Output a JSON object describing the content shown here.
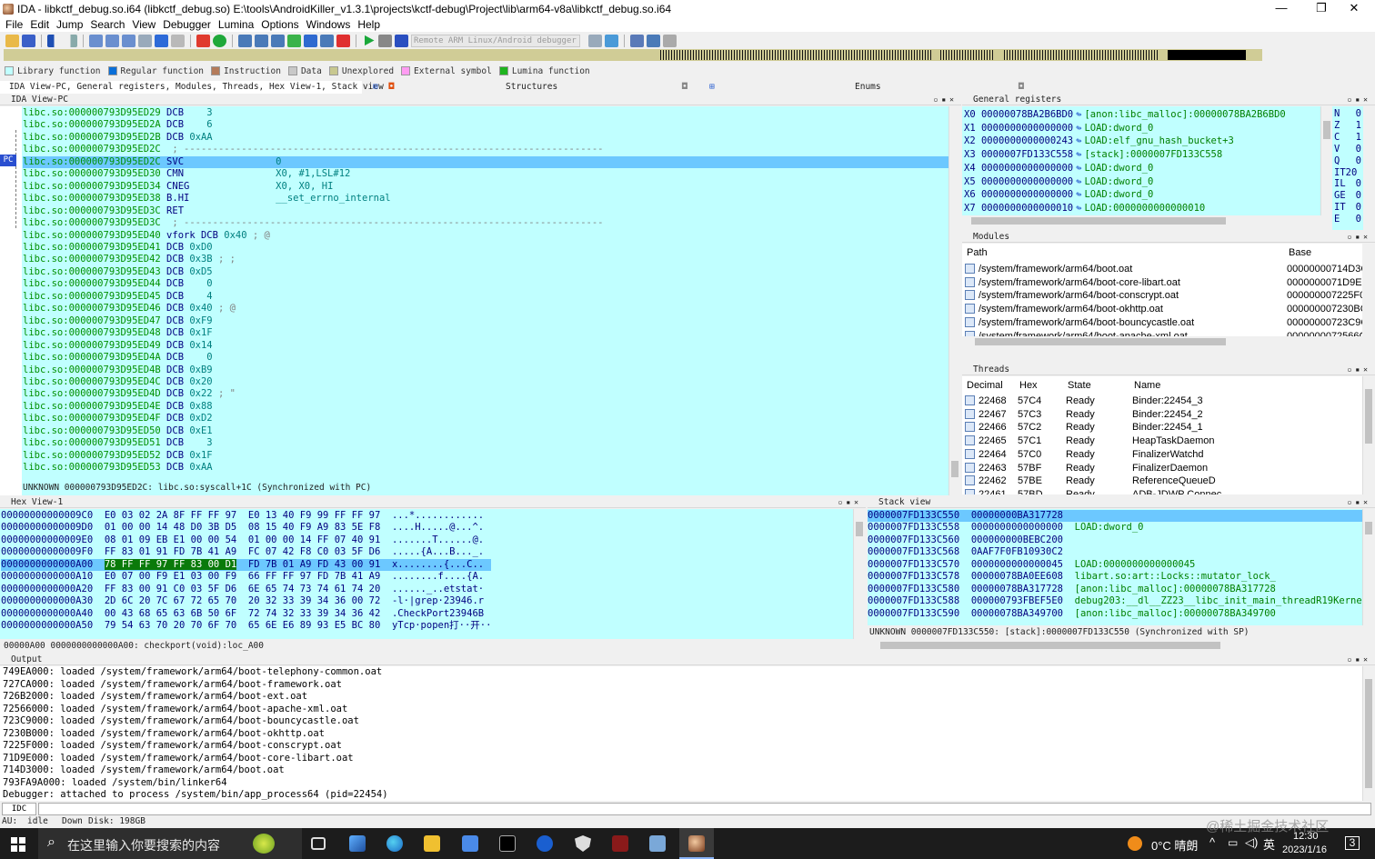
{
  "window": {
    "title": "IDA - libkctf_debug.so.i64 (libkctf_debug.so) E:\\tools\\AndroidKiller_v1.3.1\\projects\\kctf-debug\\Project\\lib\\arm64-v8a\\libkctf_debug.so.i64",
    "minimize": "—",
    "maximize": "❐",
    "close": "✕"
  },
  "menu": [
    "File",
    "Edit",
    "Jump",
    "Search",
    "View",
    "Debugger",
    "Lumina",
    "Options",
    "Windows",
    "Help"
  ],
  "toolbar": {
    "debugger_select": "Remote ARM Linux/Android debugger"
  },
  "legend": [
    {
      "label": "Library function",
      "color": "#c0ffff"
    },
    {
      "label": "Regular function",
      "color": "#0a6fd8"
    },
    {
      "label": "Instruction",
      "color": "#b47b5a"
    },
    {
      "label": "Data",
      "color": "#c8c8c8"
    },
    {
      "label": "Unexplored",
      "color": "#c8c890"
    },
    {
      "label": "External symbol",
      "color": "#ff9cf2"
    },
    {
      "label": "Lumina function",
      "color": "#1fb41f"
    }
  ],
  "tabs": {
    "main": "IDA View-PC, General registers, Modules, Threads, Hex View-1, Stack view",
    "structures": "Structures",
    "enums": "Enums"
  },
  "ida_view": {
    "title": "IDA View-PC",
    "pc_marker": "PC",
    "lines": [
      {
        "addr": "libc.so:000000793D95ED29",
        "mn": "DCB",
        "op": "   3",
        "cm": ""
      },
      {
        "addr": "libc.so:000000793D95ED2A",
        "mn": "DCB",
        "op": "   6",
        "cm": ""
      },
      {
        "addr": "libc.so:000000793D95ED2B",
        "mn": "DCB",
        "op": "0xAA",
        "cm": ""
      },
      {
        "addr": "libc.so:000000793D95ED2C",
        "mn": "",
        "op": "",
        "cm": "; -------------------------------------------------------------------------"
      },
      {
        "addr": "libc.so:000000793D95ED2C",
        "mn": "SVC",
        "op": "               0",
        "cm": "",
        "pc": true
      },
      {
        "addr": "libc.so:000000793D95ED30",
        "mn": "CMN",
        "op": "               X0, #1,LSL#12",
        "cm": ""
      },
      {
        "addr": "libc.so:000000793D95ED34",
        "mn": "CNEG",
        "op": "              X0, X0, HI",
        "cm": ""
      },
      {
        "addr": "libc.so:000000793D95ED38",
        "mn": "B.HI",
        "op": "              __set_errno_internal",
        "cm": ""
      },
      {
        "addr": "libc.so:000000793D95ED3C",
        "mn": "RET",
        "op": "",
        "cm": ""
      },
      {
        "addr": "libc.so:000000793D95ED3C",
        "mn": "",
        "op": "",
        "cm": "; -------------------------------------------------------------------------"
      },
      {
        "addr": "libc.so:000000793D95ED40",
        "mn": "vfork DCB",
        "op": "0x40",
        "cm": " ; @"
      },
      {
        "addr": "libc.so:000000793D95ED41",
        "mn": "DCB",
        "op": "0xD0",
        "cm": ""
      },
      {
        "addr": "libc.so:000000793D95ED42",
        "mn": "DCB",
        "op": "0x3B",
        "cm": " ; ;"
      },
      {
        "addr": "libc.so:000000793D95ED43",
        "mn": "DCB",
        "op": "0xD5",
        "cm": ""
      },
      {
        "addr": "libc.so:000000793D95ED44",
        "mn": "DCB",
        "op": "   0",
        "cm": ""
      },
      {
        "addr": "libc.so:000000793D95ED45",
        "mn": "DCB",
        "op": "   4",
        "cm": ""
      },
      {
        "addr": "libc.so:000000793D95ED46",
        "mn": "DCB",
        "op": "0x40",
        "cm": " ; @"
      },
      {
        "addr": "libc.so:000000793D95ED47",
        "mn": "DCB",
        "op": "0xF9",
        "cm": ""
      },
      {
        "addr": "libc.so:000000793D95ED48",
        "mn": "DCB",
        "op": "0x1F",
        "cm": ""
      },
      {
        "addr": "libc.so:000000793D95ED49",
        "mn": "DCB",
        "op": "0x14",
        "cm": ""
      },
      {
        "addr": "libc.so:000000793D95ED4A",
        "mn": "DCB",
        "op": "   0",
        "cm": ""
      },
      {
        "addr": "libc.so:000000793D95ED4B",
        "mn": "DCB",
        "op": "0xB9",
        "cm": ""
      },
      {
        "addr": "libc.so:000000793D95ED4C",
        "mn": "DCB",
        "op": "0x20",
        "cm": ""
      },
      {
        "addr": "libc.so:000000793D95ED4D",
        "mn": "DCB",
        "op": "0x22",
        "cm": " ; \""
      },
      {
        "addr": "libc.so:000000793D95ED4E",
        "mn": "DCB",
        "op": "0x88",
        "cm": ""
      },
      {
        "addr": "libc.so:000000793D95ED4F",
        "mn": "DCB",
        "op": "0xD2",
        "cm": ""
      },
      {
        "addr": "libc.so:000000793D95ED50",
        "mn": "DCB",
        "op": "0xE1",
        "cm": ""
      },
      {
        "addr": "libc.so:000000793D95ED51",
        "mn": "DCB",
        "op": "   3",
        "cm": ""
      },
      {
        "addr": "libc.so:000000793D95ED52",
        "mn": "DCB",
        "op": "0x1F",
        "cm": ""
      },
      {
        "addr": "libc.so:000000793D95ED53",
        "mn": "DCB",
        "op": "0xAA",
        "cm": ""
      }
    ],
    "status": "UNKNOWN 000000793D95ED2C: libc.so:syscall+1C (Synchronized with PC)"
  },
  "registers": {
    "title": "General registers",
    "rows": [
      {
        "name": "X0",
        "value": "00000078BA2B6BD0",
        "ref": "[anon:libc_malloc]:00000078BA2B6BD0"
      },
      {
        "name": "X1",
        "value": "0000000000000000",
        "ref": "LOAD:dword_0"
      },
      {
        "name": "X2",
        "value": "0000000000000243",
        "ref": "LOAD:elf_gnu_hash_bucket+3"
      },
      {
        "name": "X3",
        "value": "0000007FD133C558",
        "ref": "[stack]:0000007FD133C558"
      },
      {
        "name": "X4",
        "value": "0000000000000000",
        "ref": "LOAD:dword_0"
      },
      {
        "name": "X5",
        "value": "0000000000000000",
        "ref": "LOAD:dword_0"
      },
      {
        "name": "X6",
        "value": "0000000000000000",
        "ref": "LOAD:dword_0"
      },
      {
        "name": "X7",
        "value": "0000000000000010",
        "ref": "LOAD:0000000000000010"
      }
    ],
    "flags": [
      {
        "name": "N",
        "value": "0"
      },
      {
        "name": "Z",
        "value": "1"
      },
      {
        "name": "C",
        "value": "1"
      },
      {
        "name": "V",
        "value": "0"
      },
      {
        "name": "Q",
        "value": "0"
      },
      {
        "name": "IT20",
        "value": ""
      },
      {
        "name": "IL",
        "value": "0"
      },
      {
        "name": "GE",
        "value": "0"
      },
      {
        "name": "IT",
        "value": "0"
      },
      {
        "name": "E",
        "value": "0"
      }
    ]
  },
  "modules": {
    "title": "Modules",
    "columns": [
      "Path",
      "Base"
    ],
    "rows": [
      {
        "path": "/system/framework/arm64/boot.oat",
        "base": "00000000714D3C"
      },
      {
        "path": "/system/framework/arm64/boot-core-libart.oat",
        "base": "0000000071D9EC"
      },
      {
        "path": "/system/framework/arm64/boot-conscrypt.oat",
        "base": "000000007225F0"
      },
      {
        "path": "/system/framework/arm64/boot-okhttp.oat",
        "base": "000000007230BC"
      },
      {
        "path": "/system/framework/arm64/boot-bouncycastle.oat",
        "base": "00000000723C9C"
      },
      {
        "path": "/system/framework/arm64/boot-apache-xml.oat",
        "base": "0000000072566C"
      }
    ]
  },
  "threads": {
    "title": "Threads",
    "columns": [
      "Decimal",
      "Hex",
      "State",
      "Name"
    ],
    "rows": [
      {
        "dec": "22468",
        "hex": "57C4",
        "state": "Ready",
        "name": "Binder:22454_3"
      },
      {
        "dec": "22467",
        "hex": "57C3",
        "state": "Ready",
        "name": "Binder:22454_2"
      },
      {
        "dec": "22466",
        "hex": "57C2",
        "state": "Ready",
        "name": "Binder:22454_1"
      },
      {
        "dec": "22465",
        "hex": "57C1",
        "state": "Ready",
        "name": "HeapTaskDaemon"
      },
      {
        "dec": "22464",
        "hex": "57C0",
        "state": "Ready",
        "name": "FinalizerWatchd"
      },
      {
        "dec": "22463",
        "hex": "57BF",
        "state": "Ready",
        "name": "FinalizerDaemon"
      },
      {
        "dec": "22462",
        "hex": "57BE",
        "state": "Ready",
        "name": "ReferenceQueueD"
      },
      {
        "dec": "22461",
        "hex": "57BD",
        "state": "Ready",
        "name": "ADB-JDWP Connec"
      }
    ]
  },
  "hex_view": {
    "title": "Hex View-1",
    "rows": [
      {
        "addr": "00000000000009C0",
        "b1": "E0 03 02 2A 8F FF FF 97",
        "b2": "E0 13 40 F9 99 FF FF 97",
        "asc": "...*............"
      },
      {
        "addr": "00000000000009D0",
        "b1": "01 00 00 14 48 D0 3B D5",
        "b2": "08 15 40 F9 A9 83 5E F8",
        "asc": "....H.....@...^."
      },
      {
        "addr": "00000000000009E0",
        "b1": "08 01 09 EB E1 00 00 54",
        "b2": "01 00 00 14 FF 07 40 91",
        "asc": ".......T......@."
      },
      {
        "addr": "00000000000009F0",
        "b1": "FF 83 01 91 FD 7B 41 A9",
        "b2": "FC 07 42 F8 C0 03 5F D6",
        "asc": ".....{A...B..._."
      },
      {
        "addr": "0000000000000A00",
        "b1": "78 FF FF 97 FF 83 00 D1",
        "b2": "FD 7B 01 A9 FD 43 00 91",
        "asc": "x........{...C..",
        "sel": true
      },
      {
        "addr": "0000000000000A10",
        "b1": "E0 07 00 F9 E1 03 00 F9",
        "b2": "66 FF FF 97 FD 7B 41 A9",
        "asc": "........f....{A."
      },
      {
        "addr": "0000000000000A20",
        "b1": "FF 83 00 91 C0 03 5F D6",
        "b2": "6E 65 74 73 74 61 74 20",
        "asc": "......_..etstat·"
      },
      {
        "addr": "0000000000000A30",
        "b1": "2D 6C 20 7C 67 72 65 70",
        "b2": "20 32 33 39 34 36 00 72",
        "asc": "-l·|grep·23946.r"
      },
      {
        "addr": "0000000000000A40",
        "b1": "00 43 68 65 63 6B 50 6F",
        "b2": "72 74 32 33 39 34 36 42",
        "asc": ".CheckPort23946B"
      },
      {
        "addr": "0000000000000A50",
        "b1": "79 54 63 70 20 70 6F 70",
        "b2": "65 6E E6 89 93 E5 BC 80",
        "asc": "yTcp·popen打··开··"
      }
    ],
    "status": "00000A00 0000000000000A00: checkport(void):loc_A00"
  },
  "stack_view": {
    "title": "Stack view",
    "rows": [
      {
        "addr": "0000007FD133C550",
        "val": "00000000BA317728",
        "ref": "",
        "sel": true
      },
      {
        "addr": "0000007FD133C558",
        "val": "0000000000000000",
        "ref": "LOAD:dword_0"
      },
      {
        "addr": "0000007FD133C560",
        "val": "000000000BEBC200",
        "ref": ""
      },
      {
        "addr": "0000007FD133C568",
        "val": "0AAF7F0FB10930C2",
        "ref": ""
      },
      {
        "addr": "0000007FD133C570",
        "val": "0000000000000045",
        "ref": "LOAD:0000000000000045"
      },
      {
        "addr": "0000007FD133C578",
        "val": "00000078BA0EE608",
        "ref": "libart.so:art::Locks::mutator_lock_"
      },
      {
        "addr": "0000007FD133C580",
        "val": "00000078BA317728",
        "ref": "[anon:libc_malloc]:00000078BA317728"
      },
      {
        "addr": "0000007FD133C588",
        "val": "000000793FBEF5E0",
        "ref": "debug203:__dl__ZZ23__libc_init_main_threadR19Kerne"
      },
      {
        "addr": "0000007FD133C590",
        "val": "00000078BA349700",
        "ref": "[anon:libc_malloc]:00000078BA349700"
      }
    ],
    "status": "UNKNOWN 0000007FD133C550: [stack]:0000007FD133C550 (Synchronized with SP)"
  },
  "output": {
    "title": "Output",
    "lines": [
      "749EA000: loaded /system/framework/arm64/boot-telephony-common.oat",
      "727CA000: loaded /system/framework/arm64/boot-framework.oat",
      "726B2000: loaded /system/framework/arm64/boot-ext.oat",
      "72566000: loaded /system/framework/arm64/boot-apache-xml.oat",
      "723C9000: loaded /system/framework/arm64/boot-bouncycastle.oat",
      "7230B000: loaded /system/framework/arm64/boot-okhttp.oat",
      "7225F000: loaded /system/framework/arm64/boot-conscrypt.oat",
      "71D9E000: loaded /system/framework/arm64/boot-core-libart.oat",
      "714D3000: loaded /system/framework/arm64/boot.oat",
      "793FA9A000: loaded /system/bin/linker64",
      "Debugger: attached to process /system/bin/app_process64 (pid=22454)"
    ],
    "idc_label": "IDC"
  },
  "statusbar": {
    "au": "AU:",
    "state": "idle",
    "down": "Down",
    "disk": "Disk: 198GB"
  },
  "taskbar": {
    "search_placeholder": "在这里输入你要搜索的内容",
    "weather": "0°C 晴朗",
    "ime": "英",
    "time": "12:30",
    "date": "2023/1/16",
    "notif": "3",
    "watermark": "@稀土掘金技术社区"
  }
}
